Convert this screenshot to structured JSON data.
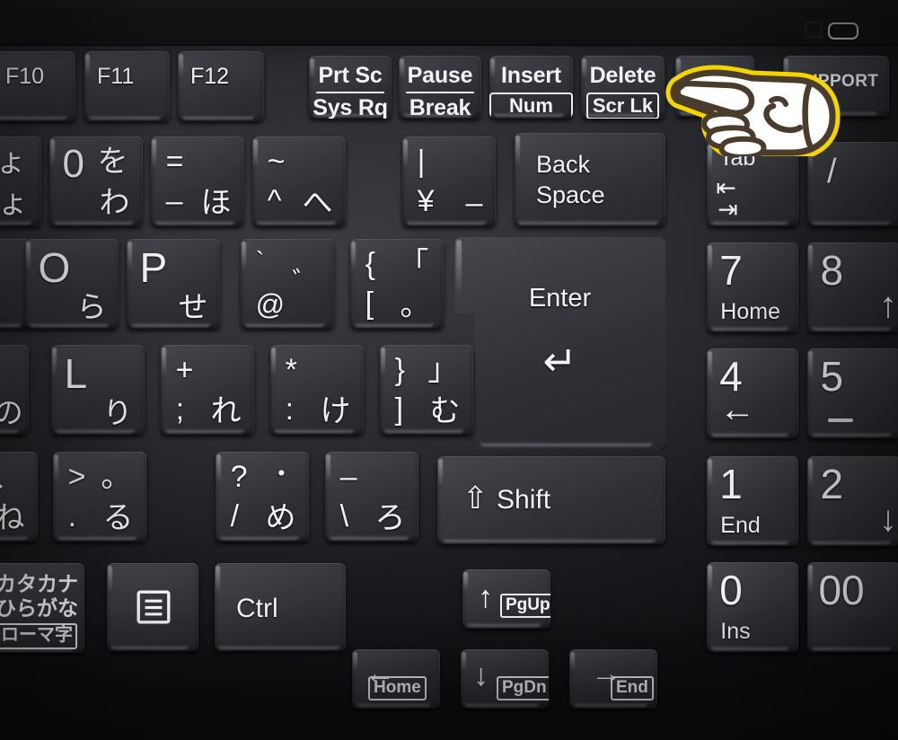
{
  "scene": {
    "title": "Japanese JIS notebook keyboard close-up with pointing-hand cursor",
    "colors": {
      "key_face": "#3a3c41",
      "deck": "#2a2c30",
      "legend": "#f2f3f4",
      "cursor_outline": "#f5d500",
      "cursor_ink": "#4a3c2c",
      "cursor_fill": "#ffffff"
    }
  },
  "bezel": {
    "indicators": [
      {
        "name": "square-indicator",
        "glyph": "square"
      },
      {
        "name": "pill-indicator",
        "glyph": "pill"
      }
    ]
  },
  "cursor": {
    "name": "pointing-hand-cursor",
    "direction": "left",
    "outline_color": "#f5d500",
    "ink_color": "#4a3c2c",
    "fill_color": "#ffffff"
  },
  "keyboard": {
    "function_row": [
      {
        "id": "f10",
        "label": "F10"
      },
      {
        "id": "f11",
        "label": "F11"
      },
      {
        "id": "f12",
        "label": "F12"
      },
      {
        "id": "prtsc",
        "top": "Prt Sc",
        "bottom": "Sys Rq",
        "style": "rule"
      },
      {
        "id": "pause",
        "top": "Pause",
        "bottom": "Break",
        "style": "rule"
      },
      {
        "id": "insert",
        "top": "Insert",
        "bottom": "Num Lk",
        "style": "box"
      },
      {
        "id": "delete",
        "top": "Delete",
        "bottom": "Scr Lk",
        "style": "box"
      },
      {
        "id": "blank-key",
        "label": ""
      },
      {
        "id": "support",
        "label": "SUPPORT"
      }
    ],
    "number_row": [
      {
        "id": "key-9-partial",
        "tl": "ょ",
        "bl": "",
        "br": "ょ",
        "partial": true
      },
      {
        "id": "key-0",
        "tr": "を",
        "bl": "0",
        "br": "わ"
      },
      {
        "id": "key-minus",
        "tl": "=",
        "bl": "–",
        "br": "ほ"
      },
      {
        "id": "key-caret",
        "tl": "~",
        "bl": "^",
        "br": "へ"
      },
      {
        "id": "key-yen",
        "tl": "|",
        "bl": "¥",
        "br": "–"
      },
      {
        "id": "key-backspace",
        "line1": "Back",
        "line2": "Space"
      },
      {
        "id": "np-tab",
        "label": "Tab",
        "glyphs": [
          "⇤",
          "⇥"
        ]
      },
      {
        "id": "np-slash",
        "label": "/"
      }
    ],
    "top_letter_row": [
      {
        "id": "key-o",
        "main": "O",
        "kana": "ら"
      },
      {
        "id": "key-p",
        "main": "P",
        "kana": "せ"
      },
      {
        "id": "key-at",
        "tl": "`",
        "tr": "゛",
        "bl": "@",
        "br": ""
      },
      {
        "id": "key-bracket-left",
        "tl": "{",
        "tr": "「",
        "bl": "[",
        "br": "。"
      },
      {
        "id": "key-enter",
        "label": "Enter",
        "arrow": "↵"
      },
      {
        "id": "np-7",
        "num": "7",
        "sub": "Home"
      },
      {
        "id": "np-8",
        "num": "8",
        "arrow": "↑"
      }
    ],
    "home_letter_row": [
      {
        "id": "key-k-partial",
        "kana": "の",
        "partial": true
      },
      {
        "id": "key-l",
        "main": "L",
        "kana": "り"
      },
      {
        "id": "key-semicolon",
        "tl": "+",
        "bl": ";",
        "br": "れ"
      },
      {
        "id": "key-colon",
        "tl": "*",
        "bl": ":",
        "br": "け"
      },
      {
        "id": "key-bracket-right",
        "tl": "}",
        "tr": "」",
        "bl": "]",
        "br": "む"
      },
      {
        "id": "np-4",
        "num": "4",
        "arrow": "←"
      },
      {
        "id": "np-5",
        "num": "5",
        "arrow": ""
      }
    ],
    "bottom_letter_row": [
      {
        "id": "key-comma",
        "tl": "<",
        "tr": "、",
        "bl": ",",
        "br": "ね"
      },
      {
        "id": "key-period",
        "tl": ">",
        "tr": "。",
        "bl": ".",
        "br": "る"
      },
      {
        "id": "key-slash",
        "tl": "?",
        "tr": "・",
        "bl": "/",
        "br": "め"
      },
      {
        "id": "key-backslash",
        "tl": "–",
        "bl": "\\",
        "br": "ろ"
      },
      {
        "id": "key-shift",
        "label": "Shift",
        "glyph": "⇧"
      },
      {
        "id": "np-1",
        "num": "1",
        "sub": "End"
      },
      {
        "id": "np-2",
        "num": "2",
        "arrow": "↓"
      }
    ],
    "modifier_row": [
      {
        "id": "key-kana",
        "line1": "カタカナ",
        "line2": "ひらがな",
        "boxed": "ローマ字"
      },
      {
        "id": "key-menu",
        "glyph": "menu-icon"
      },
      {
        "id": "key-ctrl",
        "label": "Ctrl"
      },
      {
        "id": "np-0",
        "num": "0",
        "sub": "Ins"
      },
      {
        "id": "np-00",
        "num": "00"
      }
    ],
    "arrow_cluster": [
      {
        "id": "arrow-up",
        "glyph": "↑",
        "tag": "PgUp"
      },
      {
        "id": "arrow-left",
        "glyph": "←",
        "tag": "Home"
      },
      {
        "id": "arrow-down",
        "glyph": "↓",
        "tag": "PgDn"
      },
      {
        "id": "arrow-right",
        "glyph": "→",
        "tag": "End"
      }
    ]
  }
}
